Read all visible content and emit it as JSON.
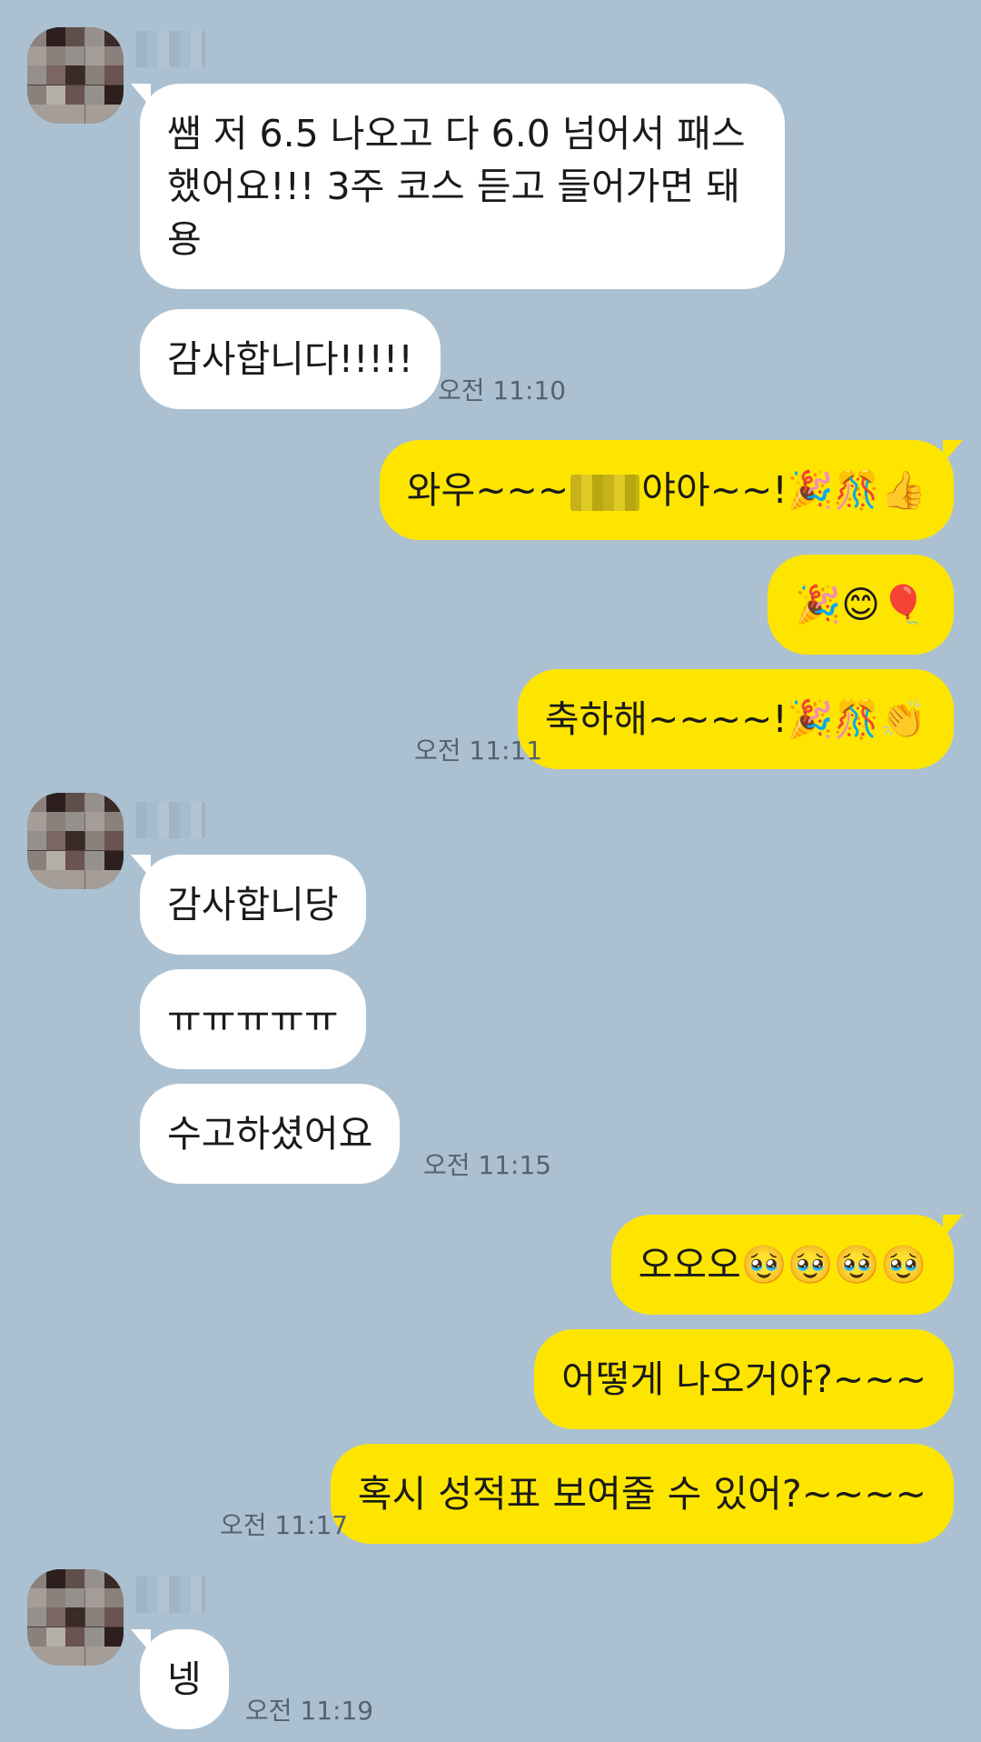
{
  "chat": {
    "block1": {
      "msg1": "쌤 저 6.5 나오고 다 6.0 넘어서 패스했어요!!! 3주 코스 듣고 들어가면 돼용",
      "msg2": "감사합니다!!!!!",
      "time": "오전 11:10"
    },
    "block2": {
      "msg1_prefix": "와우~~~",
      "msg1_suffix": "야아~~!🎉🎊👍",
      "msg2": "🎉😊🎈",
      "msg3": "축하해~~~~!🎉🎊👏",
      "time": "오전 11:11"
    },
    "block3": {
      "msg1": "감사합니당",
      "msg2": "ㅠㅠㅠㅠㅠ",
      "msg3": "수고하셨어요",
      "time": "오전 11:15"
    },
    "block4": {
      "msg1": "오오오🥹🥹🥹🥹",
      "msg2": "어떻게 나오거야?~~~",
      "msg3": "혹시 성적표 보여줄 수 있어?~~~~",
      "time": "오전 11:17"
    },
    "block5": {
      "msg1": "넹",
      "time": "오전 11:19"
    }
  },
  "colors": {
    "background": "#abc1d1",
    "incoming_bubble": "#ffffff",
    "outgoing_bubble": "#fee500"
  }
}
